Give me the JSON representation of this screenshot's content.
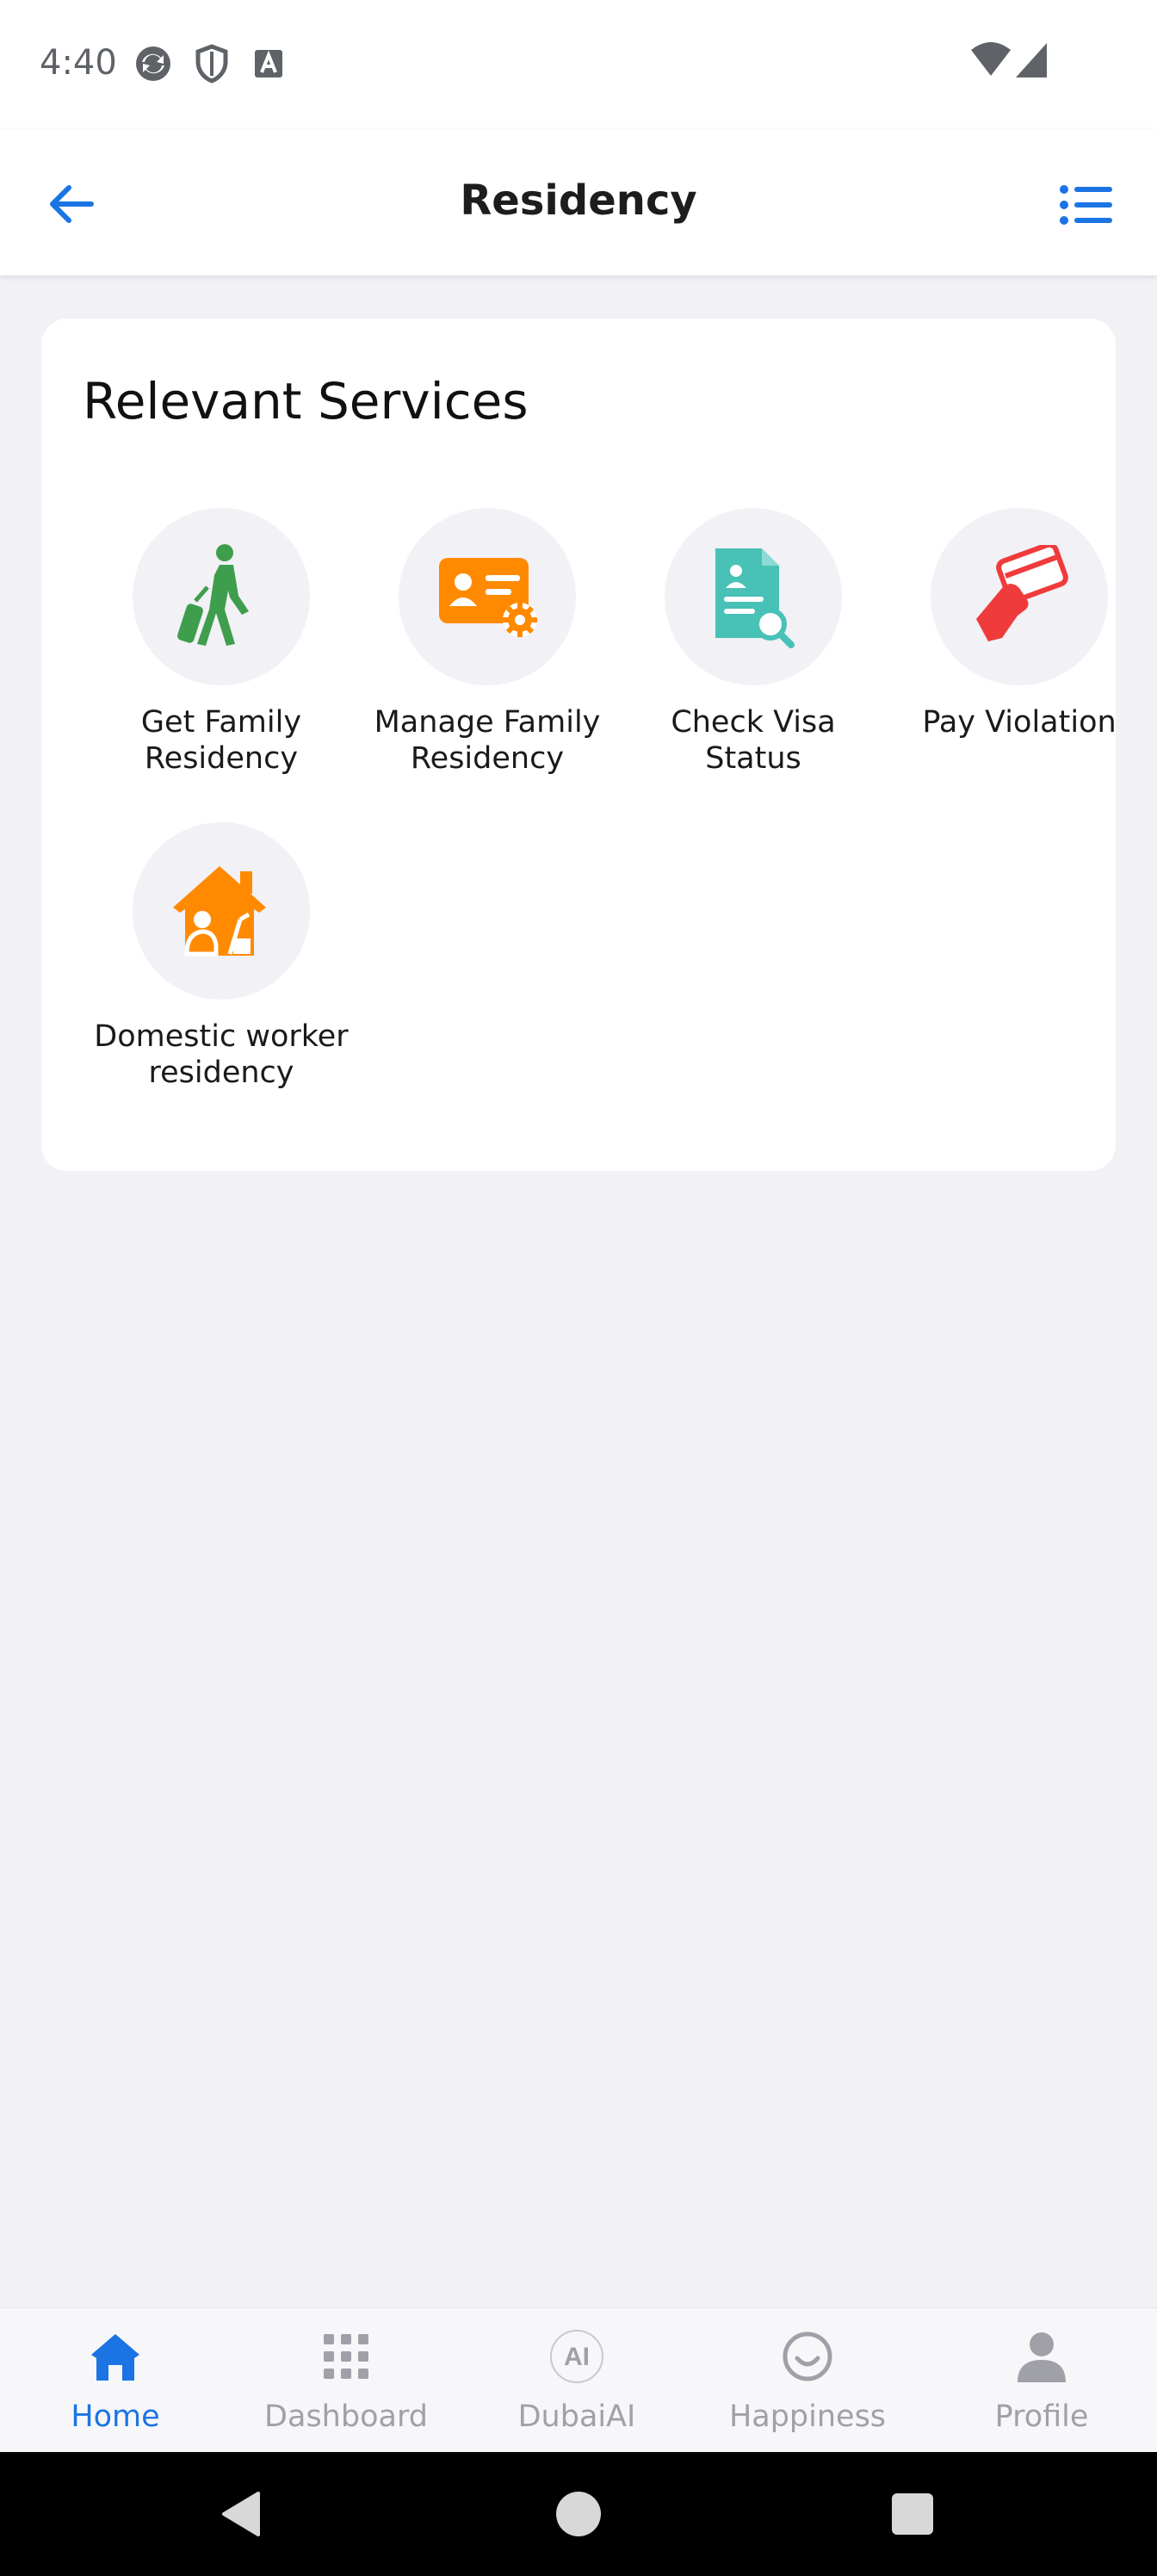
{
  "status_bar": {
    "time": "4:40",
    "icons": [
      "sync-icon",
      "shield-icon",
      "font-icon",
      "wifi-icon",
      "signal-icon"
    ]
  },
  "header": {
    "title": "Residency",
    "back_icon": "arrow-left-icon",
    "menu_icon": "list-menu-icon",
    "accent_color": "#1b74e4"
  },
  "card": {
    "title": "Relevant Services",
    "services": [
      {
        "label": "Get Family Residency",
        "icon": "walking-traveler-icon",
        "color": "#3f9e4d"
      },
      {
        "label": "Manage Family Residency",
        "icon": "id-card-gear-icon",
        "color": "#ff8a00"
      },
      {
        "label": "Check Visa Status",
        "icon": "document-search-icon",
        "color": "#48c1b7"
      },
      {
        "label": "Pay Violation",
        "icon": "hand-card-icon",
        "color": "#ef3b3b"
      },
      {
        "label": "Domestic worker residency",
        "icon": "house-worker-icon",
        "color": "#ff8a00"
      }
    ]
  },
  "bottom_nav": {
    "items": [
      {
        "label": "Home",
        "icon": "home-icon",
        "active": true
      },
      {
        "label": "Dashboard",
        "icon": "grid-icon",
        "active": false
      },
      {
        "label": "DubaiAI",
        "icon": "ai-icon",
        "active": false
      },
      {
        "label": "Happiness",
        "icon": "smile-icon",
        "active": false
      },
      {
        "label": "Profile",
        "icon": "person-icon",
        "active": false
      }
    ],
    "active_color": "#1b74e4",
    "inactive_color": "#a0a0a8"
  },
  "system_nav": {
    "icons": [
      "back-triangle-icon",
      "home-circle-icon",
      "recents-square-icon"
    ]
  }
}
